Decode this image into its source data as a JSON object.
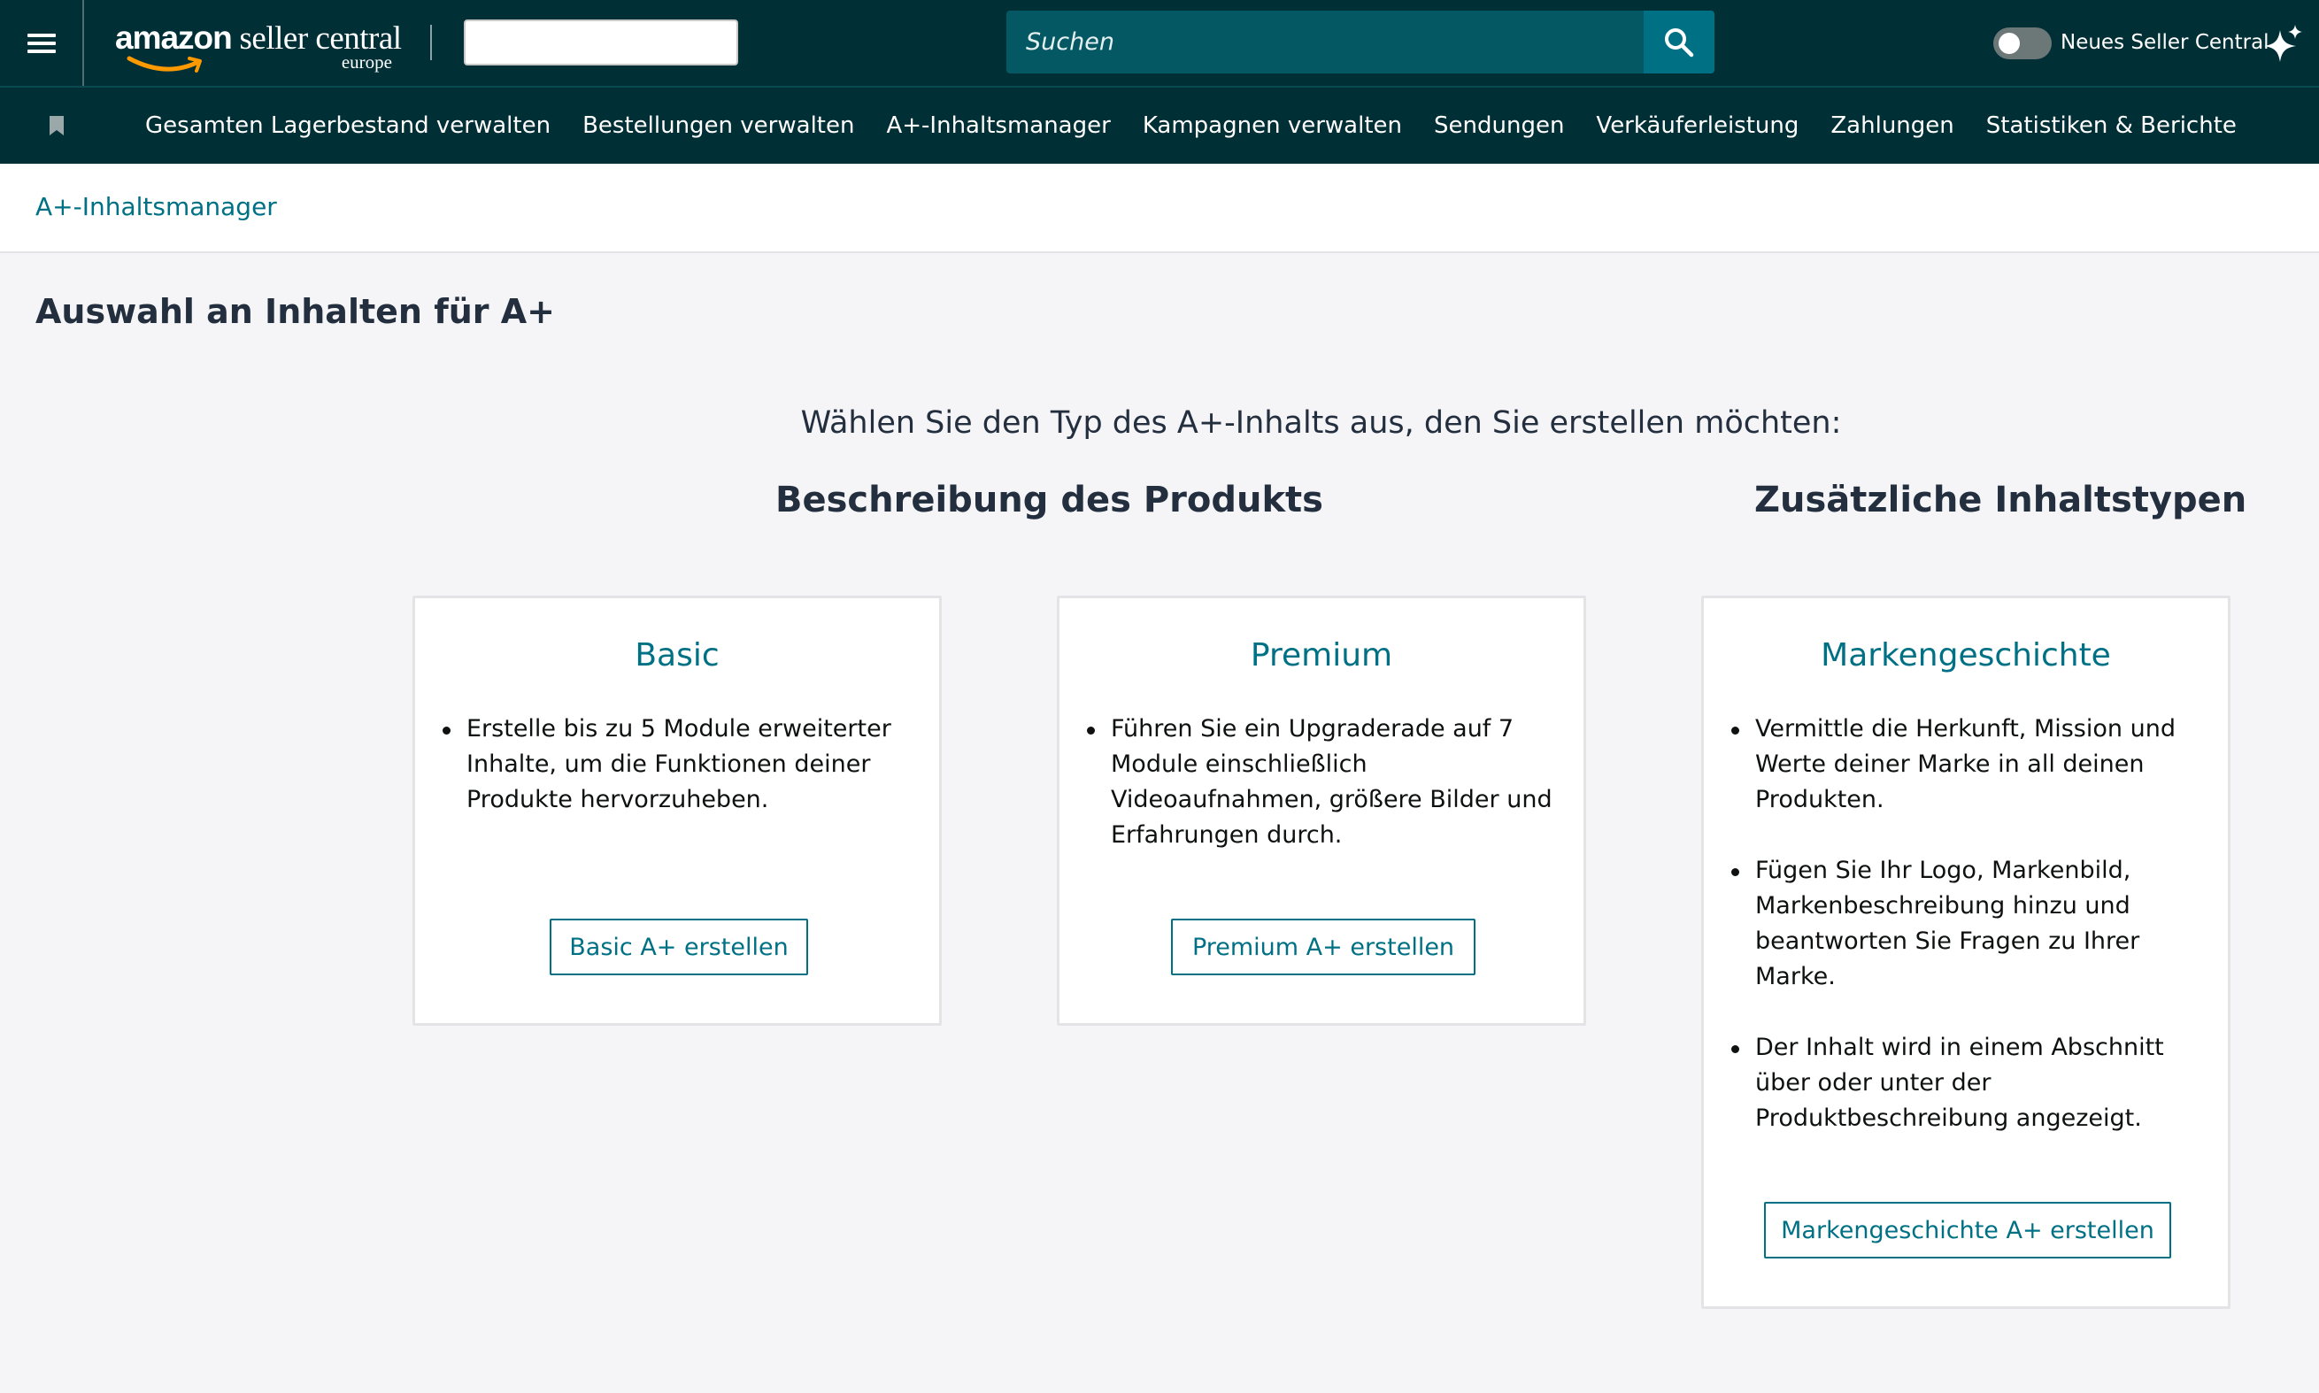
{
  "header": {
    "logo_main": "amazon",
    "logo_rest": " seller central",
    "logo_sub": "europe",
    "search_placeholder": "Suchen",
    "toggle_label": "Neues Seller Central",
    "toggle_on": false
  },
  "nav": {
    "items": [
      "Gesamten Lagerbestand verwalten",
      "Bestellungen verwalten",
      "A+-Inhaltsmanager",
      "Kampagnen verwalten",
      "Sendungen",
      "Verkäuferleistung",
      "Zahlungen",
      "Statistiken & Berichte"
    ]
  },
  "breadcrumb": "A+-Inhaltsmanager",
  "page_title": "Auswahl an Inhalten für A+",
  "prompt": "Wählen Sie den Typ des A+-Inhalts aus, den Sie erstellen möchten:",
  "sections": {
    "product_description": "Beschreibung des Produkts",
    "additional_types": "Zusätzliche Inhaltstypen"
  },
  "cards": [
    {
      "title": "Basic",
      "bullets": [
        "Erstelle bis zu 5 Module erweiterter Inhalte, um die Funktionen deiner Produkte hervorzuheben."
      ],
      "button": "Basic A+ erstellen"
    },
    {
      "title": "Premium",
      "bullets": [
        "Führen Sie ein Upgraderade auf 7 Module einschließlich Videoaufnahmen, größere Bilder und Erfahrungen durch."
      ],
      "button": "Premium A+ erstellen"
    },
    {
      "title": "Markengeschichte",
      "bullets": [
        "Vermittle die Herkunft, Mission und Werte deiner Marke in all deinen Produkten.",
        "Fügen Sie Ihr Logo, Markenbild, Markenbeschreibung hinzu und beantworten Sie Fragen zu Ihrer Marke.",
        "Der Inhalt wird in einem Abschnitt über oder unter der Produktbeschreibung angezeigt."
      ],
      "button": "Markengeschichte A+ erstellen"
    }
  ],
  "colors": {
    "header_bg": "#002f36",
    "search_bg": "#035863",
    "search_button": "#007185",
    "link": "#007185",
    "page_bg": "#f5f5f7"
  },
  "icons": [
    "hamburger-menu-icon",
    "search-icon",
    "sparkle-icon",
    "bookmark-icon"
  ]
}
